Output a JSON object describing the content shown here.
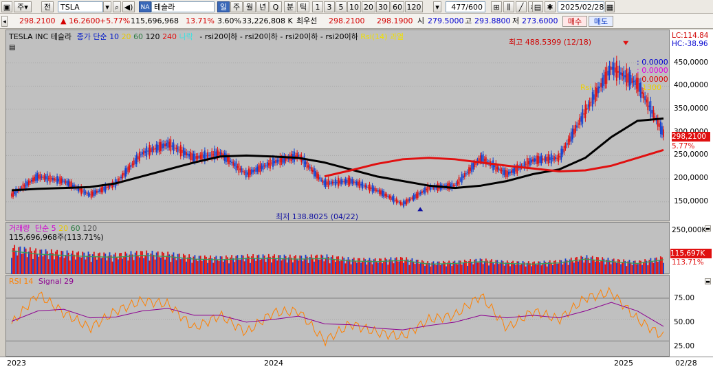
{
  "toolbar": {
    "mode1": "주",
    "mode2": "전",
    "ticker": "TSLA",
    "exch": "NA",
    "name": "테슬라",
    "periods": [
      "일",
      "주",
      "월",
      "년",
      "Q",
      "분",
      "틱"
    ],
    "period_active": "일",
    "minutes": [
      "1",
      "3",
      "5",
      "10",
      "20",
      "30",
      "60",
      "120"
    ],
    "count": "477/600",
    "date": "2025/02/28"
  },
  "quote": {
    "price": "298.2100",
    "change": "▲ 16.2600",
    "pct": "+5.77%",
    "volume": "115,696,968",
    "vol_ratio": "13.71%",
    "turnover": "3.60%",
    "amount": "33,226,808 K",
    "bid_label": "최우선",
    "bid": "298.2100",
    "ask": "298.1900",
    "open_label": "시",
    "open": "279.5000",
    "high_label": "고",
    "high": "293.8800",
    "low_label": "저",
    "low": "273.6000",
    "buy_label": "매수",
    "sell_label": "매도"
  },
  "price_legend": {
    "title": "TESLA INC  테슬라",
    "ma_prefix": "종가 단순",
    "ma10": "10",
    "ma20": "20",
    "ma60": "60",
    "ma120": "120",
    "ma240": "240",
    "cloud": "나락",
    "rsi_items": [
      "rsi20이하",
      "rsi20이하",
      "rsi20이하",
      "rsi20이하"
    ],
    "rsi_over": "Rsi(14) 과열"
  },
  "lc": "LC:114.84",
  "hc": "HC:-38.96",
  "annotations": {
    "high": "최고 488.5399 (12/18)",
    "low": "최저 138.8025 (04/22)",
    "zero1": ": 0.0000",
    "zero2": ": 0.0000",
    "zero3": ": 0.0000",
    "rsi_tag": "Rsi",
    "rsi_tag_val": "1300"
  },
  "volume_legend": {
    "title": "거래량",
    "ma_prefix": "단순",
    "ma5": "5",
    "ma20": "20",
    "ma60": "60",
    "ma120": "120",
    "info": "115,696,968주(113.71%)"
  },
  "rsi_legend": {
    "title": "RSI 14",
    "signal": "Signal 29"
  },
  "axis": {
    "price_ticks": [
      "450,0000",
      "400,0000",
      "350,0000",
      "300,0000",
      "250,0000",
      "200,0000",
      "150,0000"
    ],
    "price_tag": "298,2100",
    "price_pct": "5.77%",
    "vol_ticks": [
      "250,000K",
      "115,697K",
      "113.71%"
    ],
    "rsi_ticks": [
      "75.00",
      "50.00",
      "25.00"
    ],
    "time_labels": [
      "2023",
      "2024",
      "2025",
      "02/28"
    ]
  },
  "colors": {
    "up": "#e01010",
    "down": "#1040d0",
    "ma10": "#0018c8",
    "ma20": "#f0d000",
    "ma60": "#3a9a5a",
    "ma120": "#000000",
    "ma240": "#e01010",
    "cloud": "#c0ffff",
    "rsi": "#ff8000",
    "signal": "#8c0090"
  },
  "chart_data": [
    {
      "type": "line",
      "title": "TESLA INC 테슬라",
      "x": [
        "2023-01",
        "2023-02",
        "2023-03",
        "2023-04",
        "2023-05",
        "2023-06",
        "2023-07",
        "2023-08",
        "2023-09",
        "2023-10",
        "2023-11",
        "2023-12",
        "2024-01",
        "2024-02",
        "2024-03",
        "2024-04",
        "2024-05",
        "2024-06",
        "2024-07",
        "2024-08",
        "2024-09",
        "2024-10",
        "2024-11",
        "2024-12",
        "2025-01",
        "2025-02"
      ],
      "series": [
        {
          "name": "close",
          "values": [
            165,
            205,
            195,
            165,
            190,
            255,
            275,
            245,
            255,
            210,
            235,
            250,
            190,
            195,
            175,
            145,
            180,
            185,
            245,
            210,
            240,
            245,
            345,
            440,
            405,
            298.21
          ]
        },
        {
          "name": "120",
          "values": [
            175,
            178,
            180,
            182,
            190,
            205,
            220,
            235,
            248,
            250,
            248,
            245,
            235,
            220,
            205,
            195,
            185,
            180,
            185,
            195,
            210,
            220,
            245,
            290,
            325,
            330
          ]
        },
        {
          "name": "240",
          "values": [
            null,
            null,
            null,
            null,
            null,
            null,
            null,
            null,
            null,
            null,
            null,
            null,
            205,
            218,
            232,
            242,
            245,
            242,
            235,
            228,
            222,
            216,
            218,
            228,
            245,
            262
          ]
        }
      ],
      "ylim": [
        120,
        500
      ],
      "annotations": [
        {
          "x": "2024-12-18",
          "y": 488.5399,
          "text": "최고 488.5399 (12/18)"
        },
        {
          "x": "2024-04-22",
          "y": 138.8025,
          "text": "최저 138.8025 (04/22)"
        }
      ]
    },
    {
      "type": "bar",
      "title": "거래량",
      "categories": [
        "2023-01",
        "2023-02",
        "2023-03",
        "2023-04",
        "2023-05",
        "2023-06",
        "2023-07",
        "2023-08",
        "2023-09",
        "2023-10",
        "2023-11",
        "2023-12",
        "2024-01",
        "2024-02",
        "2024-03",
        "2024-04",
        "2024-05",
        "2024-06",
        "2024-07",
        "2024-08",
        "2024-09",
        "2024-10",
        "2024-11",
        "2024-12",
        "2025-01",
        "2025-02"
      ],
      "values": [
        185,
        160,
        150,
        140,
        135,
        150,
        140,
        120,
        115,
        125,
        125,
        120,
        125,
        105,
        100,
        110,
        80,
        85,
        100,
        85,
        80,
        90,
        120,
        100,
        85,
        115.7
      ],
      "ylim": [
        0,
        300
      ]
    },
    {
      "type": "line",
      "title": "RSI 14",
      "x": [
        "2023-01",
        "2023-02",
        "2023-03",
        "2023-04",
        "2023-05",
        "2023-06",
        "2023-07",
        "2023-08",
        "2023-09",
        "2023-10",
        "2023-11",
        "2023-12",
        "2024-01",
        "2024-02",
        "2024-03",
        "2024-04",
        "2024-05",
        "2024-06",
        "2024-07",
        "2024-08",
        "2024-09",
        "2024-10",
        "2024-11",
        "2024-12",
        "2025-01",
        "2025-02"
      ],
      "series": [
        {
          "name": "RSI 14",
          "values": [
            45,
            80,
            58,
            40,
            60,
            72,
            68,
            40,
            55,
            35,
            58,
            60,
            25,
            45,
            35,
            30,
            50,
            55,
            78,
            40,
            60,
            50,
            75,
            82,
            50,
            30
          ]
        },
        {
          "name": "Signal 29",
          "values": [
            48,
            60,
            62,
            52,
            53,
            60,
            63,
            55,
            55,
            47,
            50,
            54,
            45,
            44,
            40,
            38,
            43,
            47,
            55,
            52,
            55,
            52,
            60,
            70,
            60,
            42
          ]
        }
      ],
      "ylim": [
        10,
        95
      ]
    }
  ]
}
